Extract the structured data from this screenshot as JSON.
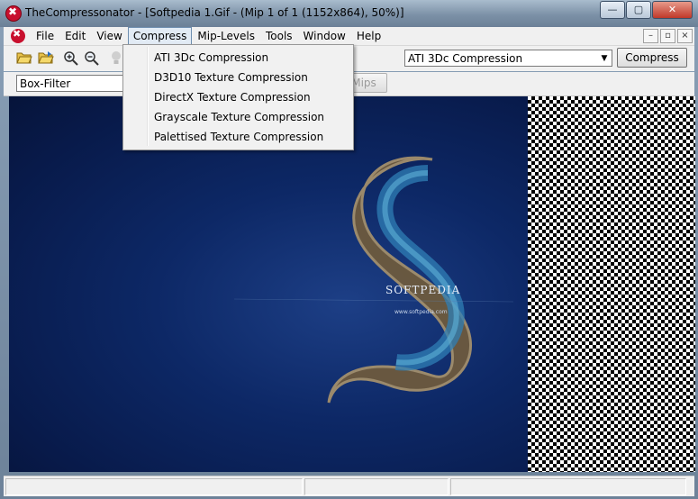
{
  "window": {
    "title": "TheCompressonator - [Softpedia 1.Gif - (Mip 1 of 1 (1152x864), 50%)]",
    "minimize_glyph": "—",
    "maximize_glyph": "▢",
    "close_glyph": "✕"
  },
  "menu": {
    "items": [
      "File",
      "Edit",
      "View",
      "Compress",
      "Mip-Levels",
      "Tools",
      "Window",
      "Help"
    ],
    "active": "Compress"
  },
  "mdi_controls": [
    "–",
    "▫",
    "×"
  ],
  "toolbar": {
    "compression_select": "ATI 3Dc Compression",
    "compress_button": "Compress"
  },
  "toolbar2": {
    "filter_select": "Box-Filter",
    "mips_button": "Mips"
  },
  "dropdown": {
    "items": [
      "ATI 3Dc Compression",
      "D3D10 Texture Compression",
      "DirectX Texture Compression",
      "Grayscale Texture Compression",
      "Palettised Texture Compression"
    ]
  },
  "image": {
    "watermark": "SOFTPEDIA",
    "url": "www.softpedia.com"
  },
  "colors": {
    "image_bg": "#0d2866",
    "titlebar": "#7c91a7",
    "chrome": "#f0f0f0"
  }
}
